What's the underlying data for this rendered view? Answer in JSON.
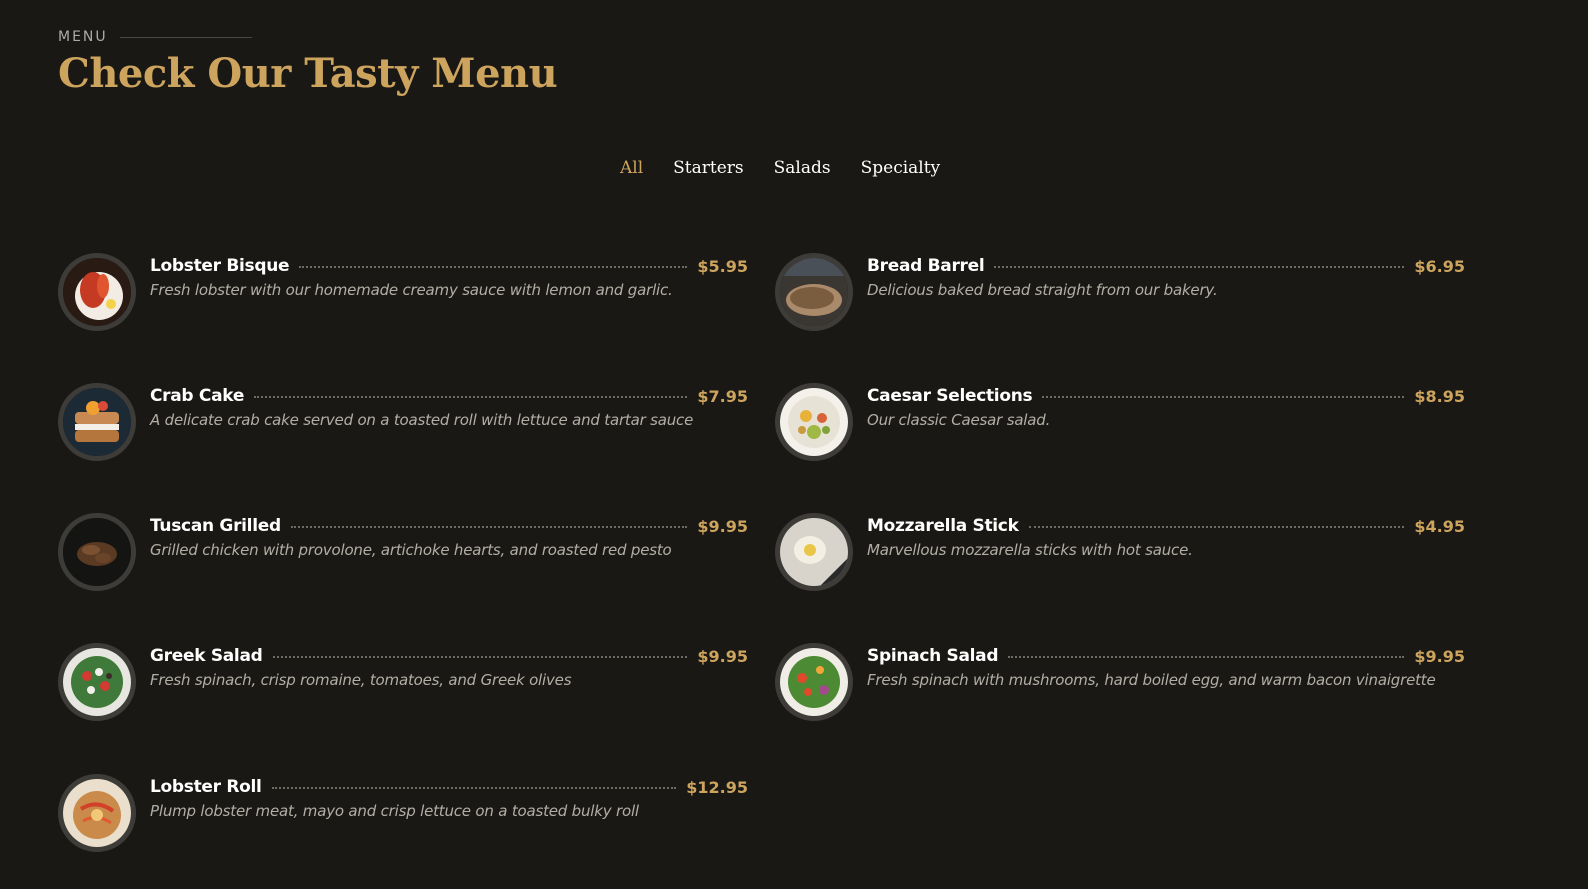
{
  "header": {
    "section_label": "MENU",
    "title": "Check Our Tasty Menu"
  },
  "filters": [
    "All",
    "Starters",
    "Salads",
    "Specialty"
  ],
  "active_filter": "All",
  "colors": {
    "background": "#1a1814",
    "accent": "#cda45e",
    "text": "#ffffff",
    "muted": "#b2aea6"
  },
  "items": [
    {
      "name": "Lobster Bisque",
      "price": "$5.95",
      "desc": "Fresh lobster with our homemade creamy sauce with lemon and garlic.",
      "image": "lobster-bisque-photo"
    },
    {
      "name": "Bread Barrel",
      "price": "$6.95",
      "desc": "Delicious baked bread straight from our bakery.",
      "image": "bread-barrel-photo"
    },
    {
      "name": "Crab Cake",
      "price": "$7.95",
      "desc": "A delicate crab cake served on a toasted roll with lettuce and tartar sauce",
      "image": "crab-cake-photo"
    },
    {
      "name": "Caesar Selections",
      "price": "$8.95",
      "desc": "Our classic Caesar salad.",
      "image": "caesar-salad-photo"
    },
    {
      "name": "Tuscan Grilled",
      "price": "$9.95",
      "desc": "Grilled chicken with provolone, artichoke hearts, and roasted red pesto",
      "image": "tuscan-grilled-photo"
    },
    {
      "name": "Mozzarella Stick",
      "price": "$4.95",
      "desc": "Marvellous mozzarella sticks with hot sauce.",
      "image": "mozzarella-stick-photo"
    },
    {
      "name": "Greek Salad",
      "price": "$9.95",
      "desc": "Fresh spinach, crisp romaine, tomatoes, and Greek olives",
      "image": "greek-salad-photo"
    },
    {
      "name": "Spinach Salad",
      "price": "$9.95",
      "desc": "Fresh spinach with mushrooms, hard boiled egg, and warm bacon vinaigrette",
      "image": "spinach-salad-photo"
    },
    {
      "name": "Lobster Roll",
      "price": "$12.95",
      "desc": "Plump lobster meat, mayo and crisp lettuce on a toasted bulky roll",
      "image": "lobster-roll-photo"
    }
  ]
}
